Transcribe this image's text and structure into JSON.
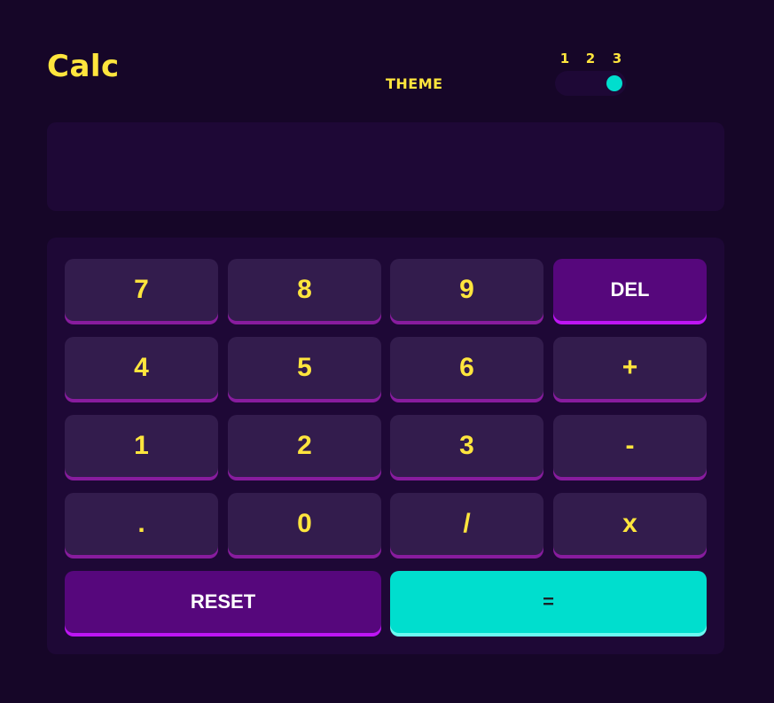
{
  "app": {
    "title": "Calc"
  },
  "theme": {
    "label": "THEME",
    "options": [
      "1",
      "2",
      "3"
    ],
    "selected_index": 2,
    "knob_color": "#00dece"
  },
  "display": {
    "value": ""
  },
  "keypad": {
    "keys": [
      {
        "label": "7",
        "kind": "num"
      },
      {
        "label": "8",
        "kind": "num"
      },
      {
        "label": "9",
        "kind": "num"
      },
      {
        "label": "DEL",
        "kind": "fn"
      },
      {
        "label": "4",
        "kind": "num"
      },
      {
        "label": "5",
        "kind": "num"
      },
      {
        "label": "6",
        "kind": "num"
      },
      {
        "label": "+",
        "kind": "num"
      },
      {
        "label": "1",
        "kind": "num"
      },
      {
        "label": "2",
        "kind": "num"
      },
      {
        "label": "3",
        "kind": "num"
      },
      {
        "label": "-",
        "kind": "num"
      },
      {
        "label": ".",
        "kind": "num"
      },
      {
        "label": "0",
        "kind": "num"
      },
      {
        "label": "/",
        "kind": "num"
      },
      {
        "label": "x",
        "kind": "num"
      },
      {
        "label": "RESET",
        "kind": "fn"
      },
      {
        "label": "=",
        "kind": "eq"
      }
    ]
  },
  "colors": {
    "background": "#160628",
    "panel": "#1e0836",
    "key": "#331c4d",
    "key_shadow": "#881c9e",
    "key_text": "#ffe53d",
    "function_key": "#56077c",
    "function_shadow": "#be15f4",
    "equals_key": "#00dece",
    "equals_shadow": "#6cf9f1"
  }
}
